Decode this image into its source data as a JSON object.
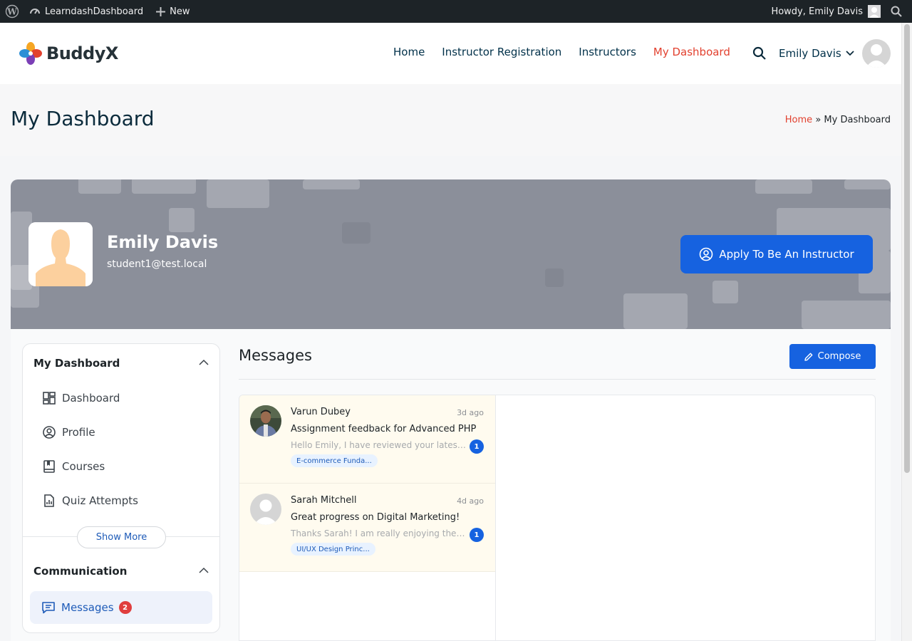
{
  "admin_bar": {
    "site_name": "LearndashDashboard",
    "new_label": "New",
    "greeting": "Howdy, Emily Davis"
  },
  "header": {
    "logo_text": "BuddyX",
    "nav": [
      {
        "label": "Home",
        "active": false
      },
      {
        "label": "Instructor Registration",
        "active": false
      },
      {
        "label": "Instructors",
        "active": false
      },
      {
        "label": "My Dashboard",
        "active": true
      }
    ],
    "user_name": "Emily Davis"
  },
  "page": {
    "title": "My Dashboard",
    "breadcrumb": {
      "home": "Home",
      "separator": "»",
      "current": "My Dashboard"
    }
  },
  "profile": {
    "name": "Emily Davis",
    "email": "student1@test.local",
    "apply_button": "Apply To Be An Instructor"
  },
  "sidebar": {
    "section1_title": "My Dashboard",
    "items": [
      {
        "label": "Dashboard",
        "icon": "dashboard-icon"
      },
      {
        "label": "Profile",
        "icon": "profile-icon"
      },
      {
        "label": "Courses",
        "icon": "courses-icon"
      },
      {
        "label": "Quiz Attempts",
        "icon": "quiz-icon"
      }
    ],
    "show_more": "Show More",
    "section2_title": "Communication",
    "messages_label": "Messages",
    "messages_count": "2"
  },
  "messages": {
    "title": "Messages",
    "compose_label": "Compose",
    "threads": [
      {
        "sender": "Varun Dubey",
        "time": "3d ago",
        "subject": "Assignment feedback for Advanced PHP",
        "preview": "Hello Emily, I have reviewed your latest submission",
        "unread": "1",
        "tag": "E-commerce Funda..."
      },
      {
        "sender": "Sarah Mitchell",
        "time": "4d ago",
        "subject": "Great progress on Digital Marketing!",
        "preview": "Thanks Sarah! I am really enjoying the course",
        "unread": "1",
        "tag": "UI/UX Design Princ..."
      }
    ]
  },
  "colors": {
    "accent": "#1662e0",
    "active_nav": "#e2412f",
    "admin_bar": "#1d2327",
    "unread_badge": "#e03e3e"
  }
}
